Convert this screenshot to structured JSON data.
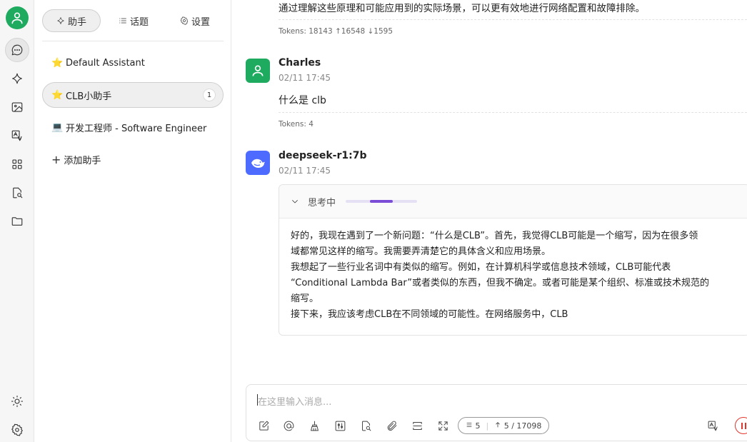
{
  "rail": {
    "items": [
      "avatar",
      "chat-icon",
      "sparkle-icon",
      "image-icon",
      "translate-icon",
      "apps-icon",
      "search-doc-icon",
      "folder-icon"
    ],
    "bottom": [
      "theme-icon",
      "settings-icon"
    ]
  },
  "panel": {
    "tabs": [
      {
        "label": "助手"
      },
      {
        "label": "话题"
      },
      {
        "label": "设置"
      }
    ],
    "assistants": [
      {
        "label": "Default Assistant",
        "emoji": "⭐"
      },
      {
        "label": "CLB小助手",
        "emoji": "⭐",
        "badge": "1"
      },
      {
        "label": "开发工程师 - Software Engineer",
        "emoji": "💻"
      }
    ],
    "add_label": "添加助手"
  },
  "chat": {
    "previous": {
      "text": "通过理解这些原理和可能应用到的实际场景，可以更有效地进行网络配置和故障排除。",
      "tokens": "Tokens: 18143 ↑16548 ↓1595"
    },
    "user_message": {
      "name": "Charles",
      "time": "02/11 17:45",
      "text": "什么是 clb",
      "tokens": "Tokens: 4"
    },
    "bot_message": {
      "name": "deepseek-r1:7b",
      "time": "02/11 17:45",
      "thinking_label": "思考中",
      "thinking_progress": 0.5,
      "thinking_lines": [
        "好的，我现在遇到了一个新问题：“什么是CLB”。首先，我觉得CLB可能是一个缩写，因为在很多领",
        "域都常见这样的缩写。我需要弄清楚它的具体含义和应用场景。",
        "我想起了一些行业名词中有类似的缩写。例如，在计算机科学或信息技术领域，CLB可能代表",
        "“Conditional Lambda Bar”或者类似的东西，但我不确定。或者可能是某个组织、标准或技术规范的",
        "缩写。",
        "接下来，我应该考虑CLB在不同领域的可能性。在网络服务中，CLB"
      ]
    }
  },
  "input": {
    "placeholder": "在这里输入消息...",
    "context_count": "5",
    "token_count": "5 / 17098"
  },
  "colors": {
    "accent_green": "#1eaa5f",
    "bot_avatar": "#4d6bfe",
    "thinking_bar": "#7b4cd6",
    "stop_red": "#e0352b"
  }
}
